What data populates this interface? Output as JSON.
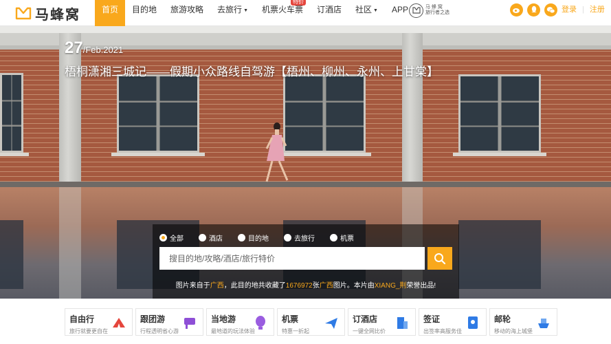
{
  "brand": {
    "logo_text": "马蜂窝",
    "partner_line1": "马 蜂 窝",
    "partner_line2": "旅行者之选"
  },
  "nav": {
    "items": [
      {
        "label": "首页",
        "active": true,
        "dropdown": false
      },
      {
        "label": "目的地",
        "active": false,
        "dropdown": false
      },
      {
        "label": "旅游攻略",
        "active": false,
        "dropdown": false
      },
      {
        "label": "去旅行",
        "active": false,
        "dropdown": true
      },
      {
        "label": "机票火车票",
        "active": false,
        "dropdown": false,
        "badge": "特价"
      },
      {
        "label": "订酒店",
        "active": false,
        "dropdown": false
      },
      {
        "label": "社区",
        "active": false,
        "dropdown": true
      },
      {
        "label": "APP",
        "active": false,
        "dropdown": false
      }
    ]
  },
  "social_icons": [
    "weibo-icon",
    "qq-icon",
    "wechat-icon"
  ],
  "auth": {
    "login": "登录",
    "register": "注册"
  },
  "hero": {
    "date_day": "27",
    "date_rest": "/Feb.2021",
    "title": "梧桐潇湘三城记——假期小众路线自驾游【梧州、柳州、永州、上甘棠】"
  },
  "search": {
    "options": [
      "全部",
      "酒店",
      "目的地",
      "去旅行",
      "机票"
    ],
    "selected": "全部",
    "placeholder": "搜目的地/攻略/酒店/旅行特价",
    "value": ""
  },
  "credit": {
    "p1": "图片来自于",
    "place": "广西",
    "p2": "，此目的地共收藏了",
    "count": "1676972",
    "p3": "张",
    "place2": "广西",
    "p4": "图片。本片由",
    "author": "XIANG_荆",
    "p5": "荣誉出品!"
  },
  "categories": [
    {
      "title": "自由行",
      "subtitle": "旅行就要更自在",
      "icon": "tent-icon",
      "color": "#e5463d"
    },
    {
      "title": "跟团游",
      "subtitle": "行程透明省心游",
      "icon": "flag-icon",
      "color": "#8e4fd6"
    },
    {
      "title": "当地游",
      "subtitle": "最地道的玩法体验",
      "icon": "balloon-icon",
      "color": "#9a5de0"
    },
    {
      "title": "机票",
      "subtitle": "特惠一折起",
      "icon": "airplane-icon",
      "color": "#2f7be5"
    },
    {
      "title": "订酒店",
      "subtitle": "一键全网比价",
      "icon": "building-icon",
      "color": "#2f7be5"
    },
    {
      "title": "签证",
      "subtitle": "出签率高服务佳",
      "icon": "passport-icon",
      "color": "#2f7be5"
    },
    {
      "title": "邮轮",
      "subtitle": "移动的海上城堡",
      "icon": "ship-icon",
      "color": "#2f7be5"
    }
  ],
  "colors": {
    "accent": "#f9a81c",
    "text": "#333333",
    "muted": "#888888"
  }
}
